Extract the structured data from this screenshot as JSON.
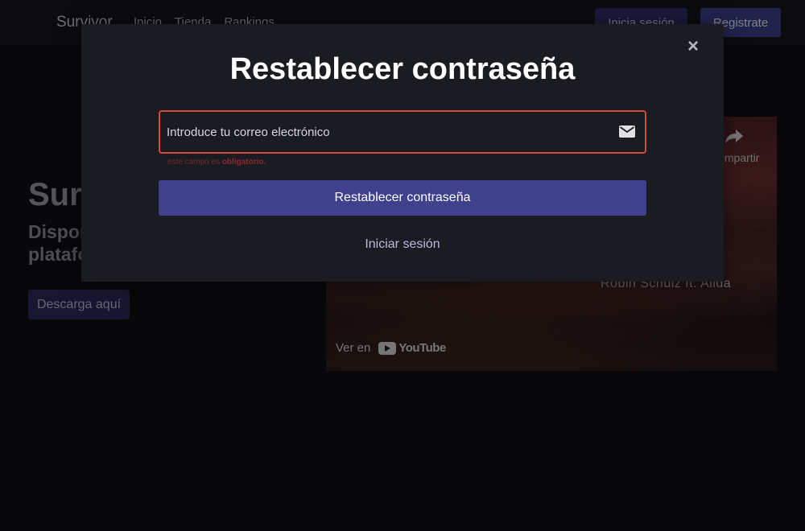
{
  "navbar": {
    "brand": "Survivor",
    "links": [
      "Inicio",
      "Tienda",
      "Rankings"
    ],
    "login_label": "Inicia sesión",
    "register_label": "Registrate"
  },
  "hero": {
    "title": "Survivor",
    "subtitle": "Disponible en todas las plataformas",
    "download_label": "Descarga aquí"
  },
  "video": {
    "share_label": "Compartir",
    "artist": "Robin Schulz ft. Alida",
    "watch_on_label": "Ver en",
    "youtube_label": "YouTube"
  },
  "modal": {
    "title": "Restablecer contraseña",
    "email_placeholder": "Introduce tu correo electrónico",
    "error_prefix": "este campo es ",
    "error_strong": "obligatorio.",
    "submit_label": "Restablecer contraseña",
    "login_link": "Iniciar sesión",
    "close_symbol": "×"
  },
  "colors": {
    "accent": "#3f418c",
    "error": "#d8473f",
    "modal_bg": "#1b1c22"
  }
}
